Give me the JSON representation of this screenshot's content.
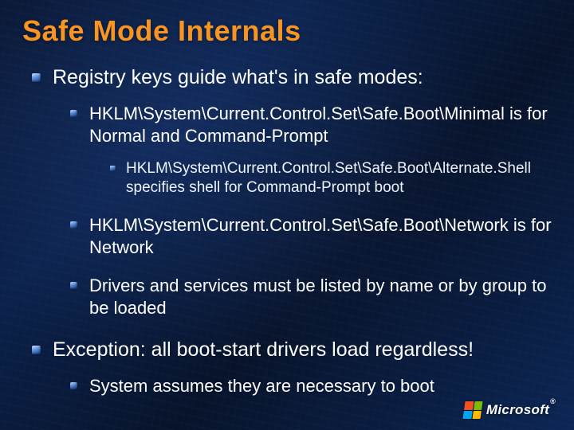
{
  "title": "Safe Mode Internals",
  "points": {
    "p1": "Registry keys guide what's in safe modes:",
    "p1a": "HKLM\\System\\Current.Control.Set\\Safe.Boot\\Minimal is for Normal and Command-Prompt",
    "p1a_i": "HKLM\\System\\Current.Control.Set\\Safe.Boot\\Alternate.Shell specifies shell for Command-Prompt boot",
    "p1b": "HKLM\\System\\Current.Control.Set\\Safe.Boot\\Network is for Network",
    "p1c": "Drivers and services must be listed by name or by group to be loaded",
    "p2": "Exception: all boot-start drivers load regardless!",
    "p2a": "System assumes they are necessary to boot"
  },
  "footer": {
    "brand": "Microsoft",
    "tm": "®"
  }
}
